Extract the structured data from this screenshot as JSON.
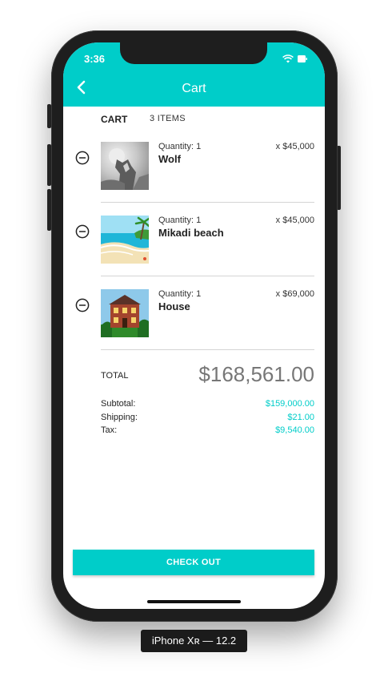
{
  "status_bar": {
    "time": "3:36"
  },
  "header": {
    "title": "Cart",
    "back_icon": "chevron-left-icon"
  },
  "cart": {
    "section_label": "CART",
    "items_count_label": "3 ITEMS",
    "items": [
      {
        "quantity_label": "Quantity: 1",
        "name": "Wolf",
        "price": "x $45,000"
      },
      {
        "quantity_label": "Quantity: 1",
        "name": "Mikadi beach",
        "price": "x $45,000"
      },
      {
        "quantity_label": "Quantity: 1",
        "name": "House",
        "price": "x $69,000"
      }
    ],
    "total_label": "TOTAL",
    "total_value": "$168,561.00",
    "summary": [
      {
        "label": "Subtotal:",
        "value": "$159,000.00"
      },
      {
        "label": "Shipping:",
        "value": "$21.00"
      },
      {
        "label": "Tax:",
        "value": "$9,540.00"
      }
    ],
    "checkout_label": "CHECK OUT"
  },
  "device_label": "iPhone Xʀ — 12.2",
  "colors": {
    "accent": "#00cdc9",
    "device": "#1e1e1e"
  }
}
